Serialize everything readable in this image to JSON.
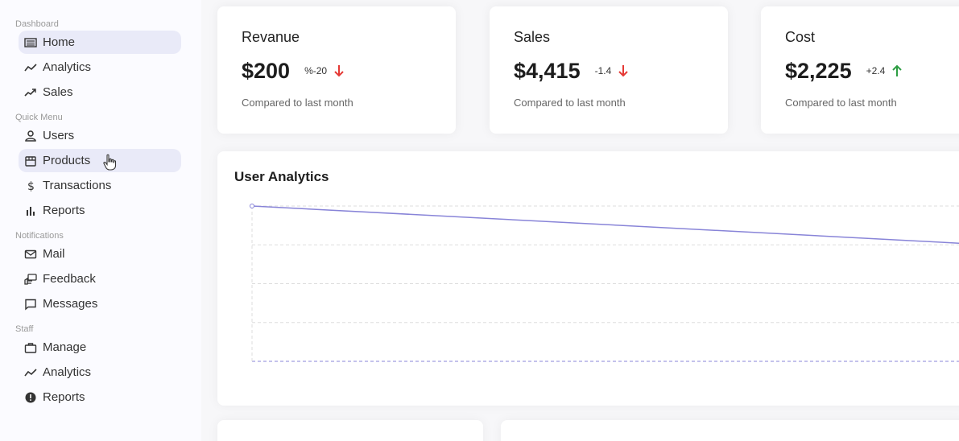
{
  "sidebar": {
    "sections": [
      {
        "title": "Dashboard",
        "items": [
          {
            "label": "Home",
            "icon": "line-chart-icon"
          },
          {
            "label": "Analytics",
            "icon": "trend-icon"
          },
          {
            "label": "Sales",
            "icon": "trend-up-icon"
          }
        ]
      },
      {
        "title": "Quick Menu",
        "items": [
          {
            "label": "Users",
            "icon": "user-icon"
          },
          {
            "label": "Products",
            "icon": "storefront-icon"
          },
          {
            "label": "Transactions",
            "icon": "dollar-icon"
          },
          {
            "label": "Reports",
            "icon": "bar-chart-icon"
          }
        ]
      },
      {
        "title": "Notifications",
        "items": [
          {
            "label": "Mail",
            "icon": "mail-icon"
          },
          {
            "label": "Feedback",
            "icon": "feedback-icon"
          },
          {
            "label": "Messages",
            "icon": "message-icon"
          }
        ]
      },
      {
        "title": "Staff",
        "items": [
          {
            "label": "Manage",
            "icon": "briefcase-icon"
          },
          {
            "label": "Analytics",
            "icon": "trend-icon"
          },
          {
            "label": "Reports",
            "icon": "report-icon"
          }
        ]
      }
    ]
  },
  "featured": [
    {
      "title": "Revanue",
      "value": "$200",
      "delta": "%-20",
      "trend": "down",
      "subtitle": "Compared to last month"
    },
    {
      "title": "Sales",
      "value": "$4,415",
      "delta": "-1.4",
      "trend": "down",
      "subtitle": "Compared to last month"
    },
    {
      "title": "Cost",
      "value": "$2,225",
      "delta": "+2.4",
      "trend": "up",
      "subtitle": "Compared to last month"
    }
  ],
  "colors": {
    "down": "#e53935",
    "up": "#2e9e44",
    "line": "#8884d8",
    "active_bg": "#e9eaf8"
  },
  "chart": {
    "title": "User Analytics"
  },
  "chart_data": {
    "type": "line",
    "title": "User Analytics",
    "series": [
      {
        "values": [
          4000,
          3000
        ]
      }
    ],
    "ylim": [
      0,
      4000
    ],
    "grid": true
  }
}
